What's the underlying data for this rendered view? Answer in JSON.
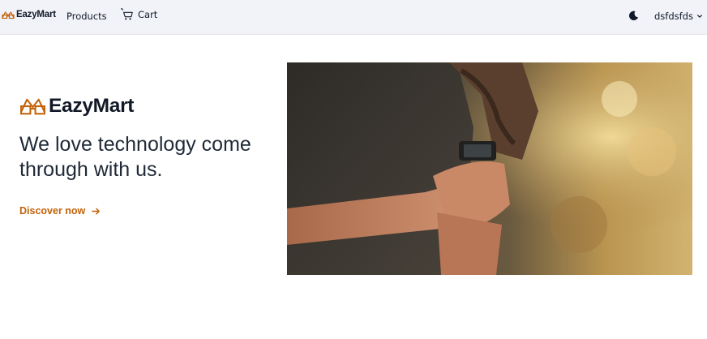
{
  "navbar": {
    "brand": "EazyMart",
    "products_label": "Products",
    "cart_label": "Cart",
    "user_name": "dsfdsfds",
    "theme_icon": "moon-icon"
  },
  "hero": {
    "brand": "EazyMart",
    "heading": "We love technology come through with us.",
    "cta_label": "Discover now",
    "image_alt": "photo"
  },
  "colors": {
    "navbar_bg": "#f1f3f9",
    "accent": "#c2620a",
    "text": "#111827"
  }
}
